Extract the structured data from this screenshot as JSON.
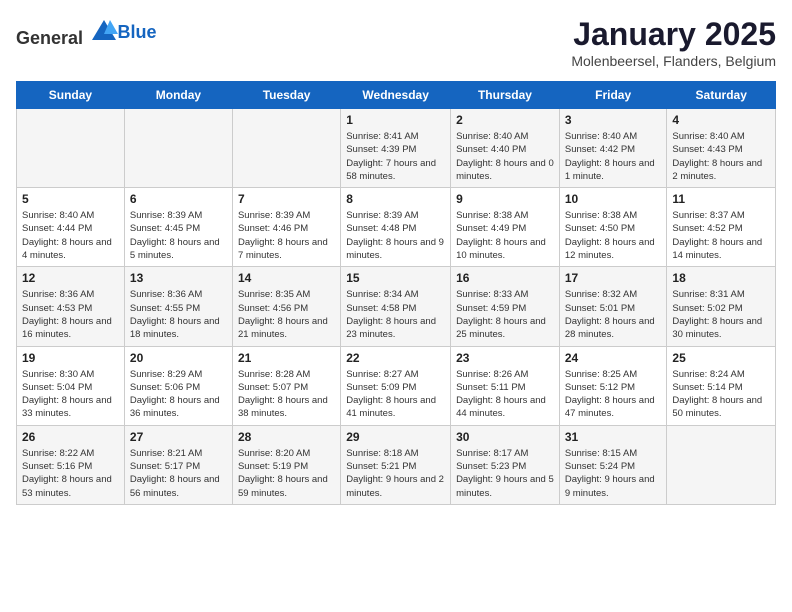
{
  "logo": {
    "text_general": "General",
    "text_blue": "Blue"
  },
  "title": "January 2025",
  "subtitle": "Molenbeersel, Flanders, Belgium",
  "days_of_week": [
    "Sunday",
    "Monday",
    "Tuesday",
    "Wednesday",
    "Thursday",
    "Friday",
    "Saturday"
  ],
  "weeks": [
    [
      {
        "day": "",
        "text": ""
      },
      {
        "day": "",
        "text": ""
      },
      {
        "day": "",
        "text": ""
      },
      {
        "day": "1",
        "text": "Sunrise: 8:41 AM\nSunset: 4:39 PM\nDaylight: 7 hours and 58 minutes."
      },
      {
        "day": "2",
        "text": "Sunrise: 8:40 AM\nSunset: 4:40 PM\nDaylight: 8 hours and 0 minutes."
      },
      {
        "day": "3",
        "text": "Sunrise: 8:40 AM\nSunset: 4:42 PM\nDaylight: 8 hours and 1 minute."
      },
      {
        "day": "4",
        "text": "Sunrise: 8:40 AM\nSunset: 4:43 PM\nDaylight: 8 hours and 2 minutes."
      }
    ],
    [
      {
        "day": "5",
        "text": "Sunrise: 8:40 AM\nSunset: 4:44 PM\nDaylight: 8 hours and 4 minutes."
      },
      {
        "day": "6",
        "text": "Sunrise: 8:39 AM\nSunset: 4:45 PM\nDaylight: 8 hours and 5 minutes."
      },
      {
        "day": "7",
        "text": "Sunrise: 8:39 AM\nSunset: 4:46 PM\nDaylight: 8 hours and 7 minutes."
      },
      {
        "day": "8",
        "text": "Sunrise: 8:39 AM\nSunset: 4:48 PM\nDaylight: 8 hours and 9 minutes."
      },
      {
        "day": "9",
        "text": "Sunrise: 8:38 AM\nSunset: 4:49 PM\nDaylight: 8 hours and 10 minutes."
      },
      {
        "day": "10",
        "text": "Sunrise: 8:38 AM\nSunset: 4:50 PM\nDaylight: 8 hours and 12 minutes."
      },
      {
        "day": "11",
        "text": "Sunrise: 8:37 AM\nSunset: 4:52 PM\nDaylight: 8 hours and 14 minutes."
      }
    ],
    [
      {
        "day": "12",
        "text": "Sunrise: 8:36 AM\nSunset: 4:53 PM\nDaylight: 8 hours and 16 minutes."
      },
      {
        "day": "13",
        "text": "Sunrise: 8:36 AM\nSunset: 4:55 PM\nDaylight: 8 hours and 18 minutes."
      },
      {
        "day": "14",
        "text": "Sunrise: 8:35 AM\nSunset: 4:56 PM\nDaylight: 8 hours and 21 minutes."
      },
      {
        "day": "15",
        "text": "Sunrise: 8:34 AM\nSunset: 4:58 PM\nDaylight: 8 hours and 23 minutes."
      },
      {
        "day": "16",
        "text": "Sunrise: 8:33 AM\nSunset: 4:59 PM\nDaylight: 8 hours and 25 minutes."
      },
      {
        "day": "17",
        "text": "Sunrise: 8:32 AM\nSunset: 5:01 PM\nDaylight: 8 hours and 28 minutes."
      },
      {
        "day": "18",
        "text": "Sunrise: 8:31 AM\nSunset: 5:02 PM\nDaylight: 8 hours and 30 minutes."
      }
    ],
    [
      {
        "day": "19",
        "text": "Sunrise: 8:30 AM\nSunset: 5:04 PM\nDaylight: 8 hours and 33 minutes."
      },
      {
        "day": "20",
        "text": "Sunrise: 8:29 AM\nSunset: 5:06 PM\nDaylight: 8 hours and 36 minutes."
      },
      {
        "day": "21",
        "text": "Sunrise: 8:28 AM\nSunset: 5:07 PM\nDaylight: 8 hours and 38 minutes."
      },
      {
        "day": "22",
        "text": "Sunrise: 8:27 AM\nSunset: 5:09 PM\nDaylight: 8 hours and 41 minutes."
      },
      {
        "day": "23",
        "text": "Sunrise: 8:26 AM\nSunset: 5:11 PM\nDaylight: 8 hours and 44 minutes."
      },
      {
        "day": "24",
        "text": "Sunrise: 8:25 AM\nSunset: 5:12 PM\nDaylight: 8 hours and 47 minutes."
      },
      {
        "day": "25",
        "text": "Sunrise: 8:24 AM\nSunset: 5:14 PM\nDaylight: 8 hours and 50 minutes."
      }
    ],
    [
      {
        "day": "26",
        "text": "Sunrise: 8:22 AM\nSunset: 5:16 PM\nDaylight: 8 hours and 53 minutes."
      },
      {
        "day": "27",
        "text": "Sunrise: 8:21 AM\nSunset: 5:17 PM\nDaylight: 8 hours and 56 minutes."
      },
      {
        "day": "28",
        "text": "Sunrise: 8:20 AM\nSunset: 5:19 PM\nDaylight: 8 hours and 59 minutes."
      },
      {
        "day": "29",
        "text": "Sunrise: 8:18 AM\nSunset: 5:21 PM\nDaylight: 9 hours and 2 minutes."
      },
      {
        "day": "30",
        "text": "Sunrise: 8:17 AM\nSunset: 5:23 PM\nDaylight: 9 hours and 5 minutes."
      },
      {
        "day": "31",
        "text": "Sunrise: 8:15 AM\nSunset: 5:24 PM\nDaylight: 9 hours and 9 minutes."
      },
      {
        "day": "",
        "text": ""
      }
    ]
  ]
}
